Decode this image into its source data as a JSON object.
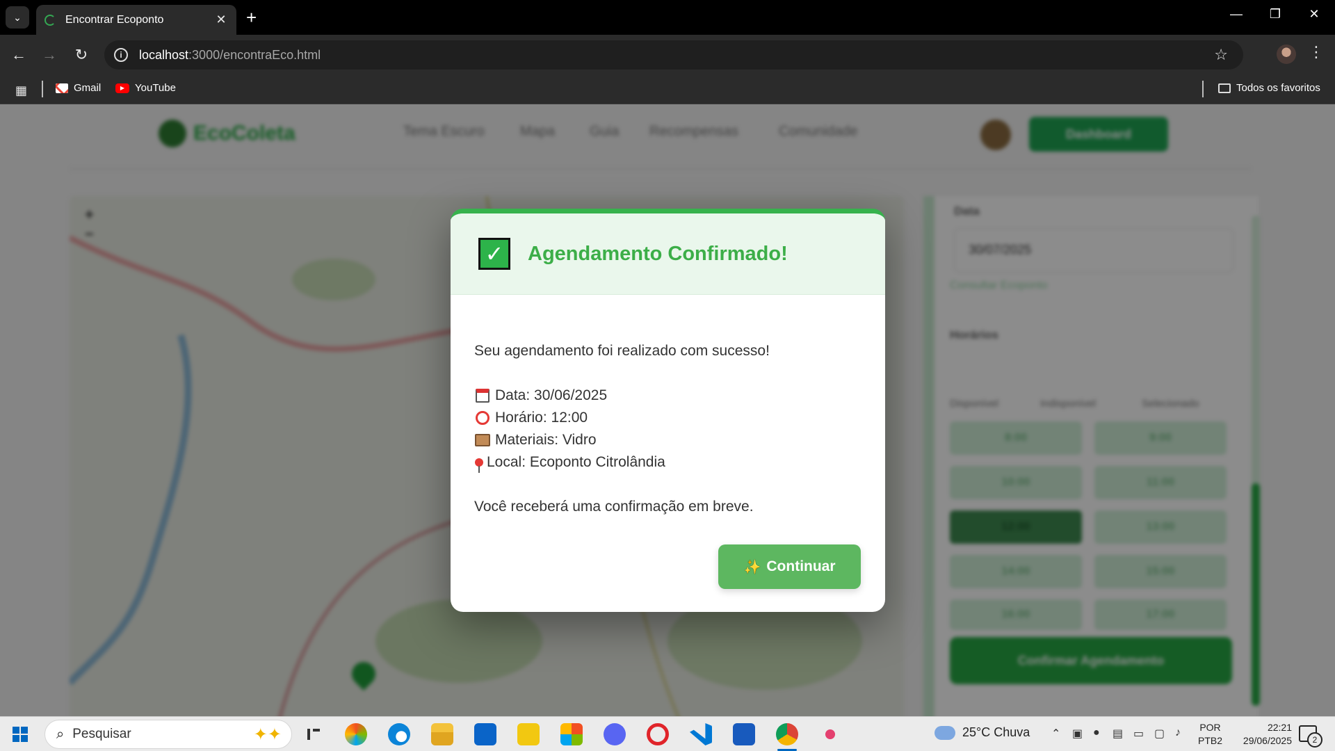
{
  "browser": {
    "tab_title": "Encontrar Ecoponto",
    "url_host": "localhost",
    "url_path": ":3000/encontraEco.html",
    "bookmarks": [
      {
        "label": "Gmail",
        "icon": "gmail-icon"
      },
      {
        "label": "YouTube",
        "icon": "youtube-icon"
      }
    ],
    "all_bookmarks_label": "Todos os favoritos"
  },
  "site": {
    "logo_text": "EcoColeta",
    "nav_links": [
      "Tema Escuro",
      "Mapa",
      "Guia",
      "Recompensas",
      "Comunidade"
    ],
    "header_button": "Dashboard",
    "date_label": "Data",
    "date_value": "30/07/2025",
    "change_link": "Consultar Ecoponto",
    "times_label": "Horários",
    "legend": [
      "Disponível",
      "Indisponível",
      "Selecionado"
    ],
    "slots": [
      "8:00",
      "9:00",
      "10:00",
      "11:00",
      "12:00",
      "13:00",
      "14:00",
      "15:00",
      "16:00",
      "17:00"
    ],
    "selected_slot_index": 4,
    "confirm_button": "Confirmar Agendamento"
  },
  "modal": {
    "title": "Agendamento Confirmado!",
    "success_message": "Seu agendamento foi realizado com sucesso!",
    "details": {
      "date": "Data: 30/06/2025",
      "time": "Horário: 12:00",
      "materials": "Materiais: Vidro",
      "location": "Local: Ecoponto Citrolândia"
    },
    "footer_message": "Você receberá uma confirmação em breve.",
    "continue_label": "Continuar"
  },
  "taskbar": {
    "search_placeholder": "Pesquisar",
    "weather": "25°C  Chuva",
    "language": "POR",
    "keyboard": "PTB2",
    "time": "22:21",
    "date": "29/06/2025",
    "notification_count": "2"
  },
  "colors": {
    "brand_green": "#27a844",
    "modal_title": "#3cae48",
    "continue_button": "#5db760"
  }
}
